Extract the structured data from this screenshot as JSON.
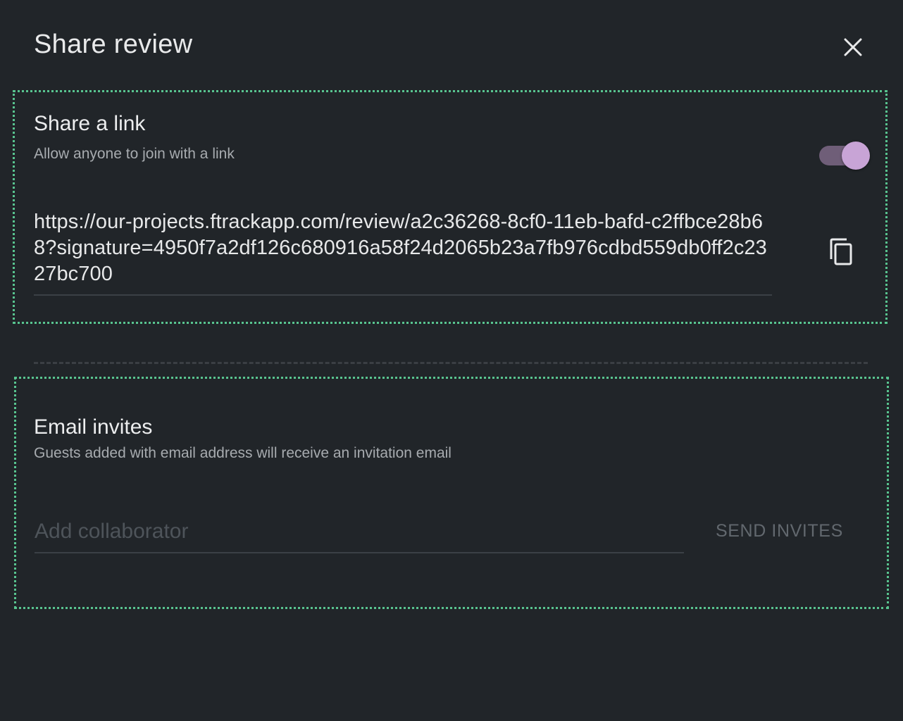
{
  "dialog": {
    "title": "Share review",
    "close_icon": "close-icon"
  },
  "share_link": {
    "heading": "Share a link",
    "subtitle": "Allow anyone to join with a link",
    "toggle_on": true,
    "toggle_track_color": "#6f5e78",
    "toggle_thumb_color": "#c8a4d6",
    "url": "https://our-projects.ftrackapp.com/review/a2c36268-8cf0-11eb-bafd-c2ffbce28b68?signature=4950f7a2df126c680916a58f24d2065b23a7fb976cdbd559db0ff2c2327bc700",
    "copy_icon": "copy-icon"
  },
  "email_invites": {
    "heading": "Email invites",
    "subtitle": "Guests added with email address will receive an invitation email",
    "input_placeholder": "Add collaborator",
    "input_value": "",
    "send_label": "SEND INVITES"
  },
  "colors": {
    "background": "#212529",
    "section_outline": "#58c48f",
    "accent": "#c8a4d6"
  }
}
